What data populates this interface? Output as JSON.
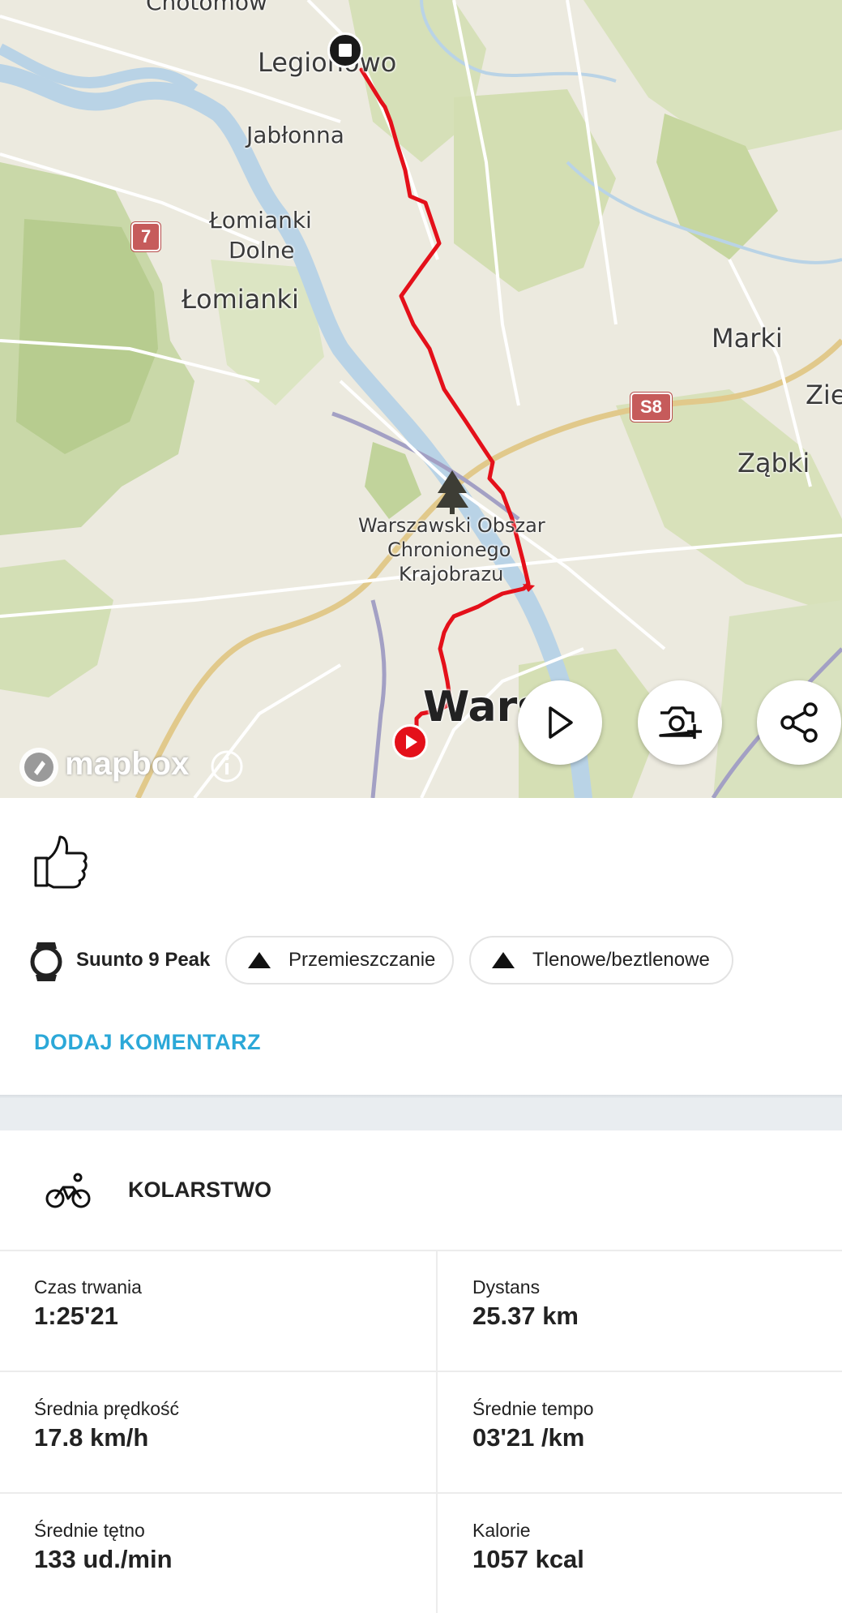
{
  "map": {
    "labels": {
      "chotomow": "Chotomów",
      "legionowo": "Legionowo",
      "jablonna": "Jabłonna",
      "lomianki_dolne_1": "Łomianki",
      "lomianki_dolne_2": "Dolne",
      "lomianki": "Łomianki",
      "marki": "Marki",
      "zielonka": "Zie",
      "zabki": "Ząbki",
      "reserve_1": "Warszawski Obszar",
      "reserve_2": "Chronionego",
      "reserve_3": "Krajobrazu",
      "warsaw": "Wars"
    },
    "shields": {
      "s7": "7",
      "s8": "S8"
    },
    "attribution": "mapbox",
    "route_color": "#e4101a",
    "icons": {
      "start": "play-marker-icon",
      "end": "stop-marker-icon",
      "replay": "play-icon",
      "add_photo": "camera-plus-icon",
      "share": "share-icon",
      "info": "info-icon",
      "park": "tree-icon"
    }
  },
  "actions": {
    "like_icon": "thumbs-up-icon"
  },
  "device": {
    "icon": "watch-icon",
    "name": "Suunto 9 Peak"
  },
  "tags": [
    {
      "label": "Przemieszczanie",
      "icon": "triangle-icon"
    },
    {
      "label": "Tlenowe/beztlenowe",
      "icon": "triangle-icon"
    }
  ],
  "add_comment_label": "DODAJ KOMENTARZ",
  "accent_color": "#2ba8d8",
  "activity": {
    "icon": "bicycle-icon",
    "type_label": "KOLARSTWO"
  },
  "stats": [
    {
      "label": "Czas trwania",
      "value": "1:25'21"
    },
    {
      "label": "Dystans",
      "value": "25.37 km"
    },
    {
      "label": "Średnia prędkość",
      "value": "17.8 km/h"
    },
    {
      "label": "Średnie tempo",
      "value": "03'21 /km"
    },
    {
      "label": "Średnie tętno",
      "value": "133 ud./min"
    },
    {
      "label": "Kalorie",
      "value": "1057 kcal"
    }
  ]
}
